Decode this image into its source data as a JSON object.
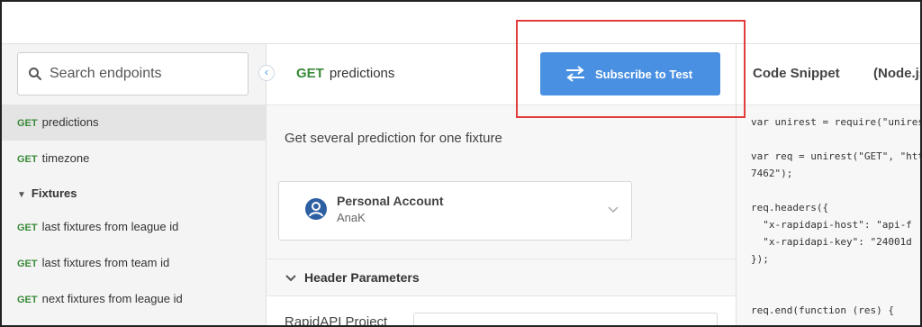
{
  "search": {
    "placeholder": "Search endpoints"
  },
  "sidebar": {
    "items": [
      {
        "method": "GET",
        "label": "predictions",
        "active": true
      },
      {
        "method": "GET",
        "label": "timezone",
        "active": false
      }
    ],
    "section": {
      "label": "Fixtures"
    },
    "section_items": [
      {
        "method": "GET",
        "label": "last fixtures from league id"
      },
      {
        "method": "GET",
        "label": "last fixtures from team id"
      },
      {
        "method": "GET",
        "label": "next fixtures from league id"
      }
    ]
  },
  "endpoint": {
    "method": "GET",
    "name": "predictions",
    "description": "Get several prediction for one fixture"
  },
  "subscribe_button": {
    "label": "Subscribe to Test"
  },
  "account": {
    "label": "Personal Account",
    "name": "AnaK"
  },
  "header_params": {
    "label": "Header Parameters"
  },
  "rapid_project": {
    "label": "RapidAPI Project"
  },
  "code_panel": {
    "tab_snippet": "Code Snippet",
    "tab_lang": "(Node.js",
    "lines": [
      "var unirest = require(\"unires",
      "",
      "var req = unirest(\"GET\", \"htt",
      "7462\");",
      "",
      "req.headers({",
      "  \"x-rapidapi-host\": \"api-f",
      "  \"x-rapidapi-key\": \"24001d",
      "});",
      "",
      "",
      "req.end(function (res) {"
    ]
  },
  "colors": {
    "accent": "#4a90e2",
    "method_green": "#3a8a3a",
    "annotation_red": "#e23c3c"
  }
}
